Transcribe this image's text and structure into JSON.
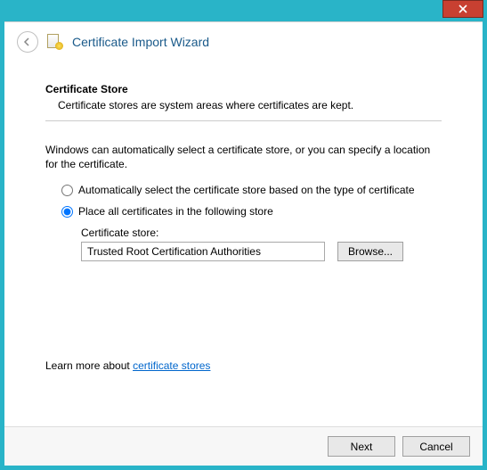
{
  "header": {
    "title": "Certificate Import Wizard"
  },
  "section": {
    "heading": "Certificate Store",
    "description": "Certificate stores are system areas where certificates are kept."
  },
  "body": {
    "intro": "Windows can automatically select a certificate store, or you can specify a location for the certificate.",
    "radio_auto": "Automatically select the certificate store based on the type of certificate",
    "radio_place": "Place all certificates in the following store",
    "store_label": "Certificate store:",
    "store_value": "Trusted Root Certification Authorities",
    "browse_label": "Browse..."
  },
  "learn": {
    "prefix": "Learn more about ",
    "link": "certificate stores"
  },
  "footer": {
    "next": "Next",
    "cancel": "Cancel"
  }
}
